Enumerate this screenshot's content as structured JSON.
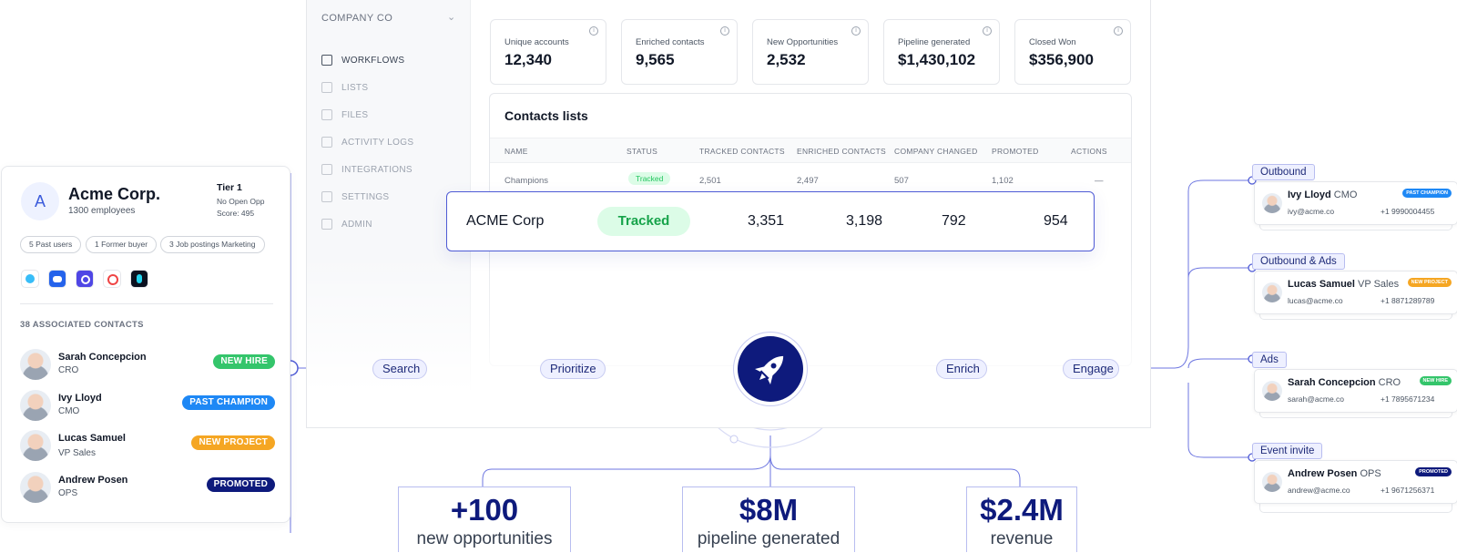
{
  "dashboard": {
    "company": "COMPANY CO",
    "nav": [
      {
        "label": "WORKFLOWS",
        "icon": "contacts-book-icon",
        "active": true
      },
      {
        "label": "LISTS",
        "icon": "list-icon",
        "active": false
      },
      {
        "label": "FILES",
        "icon": "file-icon",
        "active": false
      },
      {
        "label": "ACTIVITY LOGS",
        "icon": "book-icon",
        "active": false
      },
      {
        "label": "INTEGRATIONS",
        "icon": "integrations-icon",
        "active": false
      },
      {
        "label": "SETTINGS",
        "icon": "gear-icon",
        "active": false
      },
      {
        "label": "ADMIN",
        "icon": "building-icon",
        "active": false
      }
    ],
    "stats": [
      {
        "label": "Unique accounts",
        "value": "12,340"
      },
      {
        "label": "Enriched contacts",
        "value": "9,565"
      },
      {
        "label": "New Opportunities",
        "value": "2,532"
      },
      {
        "label": "Pipeline generated",
        "value": "$1,430,102"
      },
      {
        "label": "Closed Won",
        "value": "$356,900"
      }
    ],
    "contacts_list": {
      "title": "Contacts lists",
      "columns": [
        "NAME",
        "STATUS",
        "TRACKED CONTACTS",
        "ENRICHED CONTACTS",
        "COMPANY CHANGED",
        "PROMOTED",
        "ACTIONS"
      ],
      "row": {
        "name": "Champions",
        "status": "Tracked",
        "tracked": "2,501",
        "enriched": "2,497",
        "changed": "507",
        "promoted": "1,102",
        "actions": "—"
      }
    }
  },
  "highlight_row": {
    "name": "ACME Corp",
    "status": "Tracked",
    "tracked": "3,351",
    "enriched": "3,198",
    "changed": "792",
    "promoted": "954"
  },
  "account": {
    "initial": "A",
    "name": "Acme Corp.",
    "employees": "1300 employees",
    "tier": "Tier 1",
    "opp": "No Open Opp",
    "score": "Score: 495",
    "chips": [
      "5 Past users",
      "1 Former buyer",
      "3 Job postings Marketing"
    ],
    "apps": [
      "salesforce-icon",
      "zoom-icon",
      "pointer-icon",
      "twilio-icon",
      "dark-app-icon"
    ],
    "contacts_heading": "38 ASSOCIATED CONTACTS",
    "contacts": [
      {
        "name": "Sarah Concepcion",
        "role": "CRO",
        "badge": "NEW HIRE",
        "color": "#34c56b"
      },
      {
        "name": "Ivy Lloyd",
        "role": "CMO",
        "badge": "PAST CHAMPION",
        "color": "#1e88f5"
      },
      {
        "name": "Lucas Samuel",
        "role": "VP Sales",
        "badge": "NEW PROJECT",
        "color": "#f5a623"
      },
      {
        "name": "Andrew Posen",
        "role": "OPS",
        "badge": "PROMOTED",
        "color": "#0e1a7c"
      }
    ]
  },
  "steps": [
    "Search",
    "Prioritize",
    "Enrich",
    "Engage"
  ],
  "kpis": [
    {
      "value": "+100",
      "label": "new opportunities"
    },
    {
      "value": "$8M",
      "label": "pipeline generated"
    },
    {
      "value": "$2.4M",
      "label": "revenue"
    }
  ],
  "engage": [
    {
      "channel": "Outbound",
      "name": "Ivy Lloyd",
      "role": "CMO",
      "email": "ivy@acme.co",
      "phone": "+1 9990004455",
      "badge": "PAST CHAMPION",
      "color": "#1e88f5"
    },
    {
      "channel": "Outbound & Ads",
      "name": "Lucas Samuel",
      "role": "VP Sales",
      "email": "lucas@acme.co",
      "phone": "+1 8871289789",
      "badge": "NEW PROJECT",
      "color": "#f5a623"
    },
    {
      "channel": "Ads",
      "name": "Sarah Concepcion",
      "role": "CRO",
      "email": "sarah@acme.co",
      "phone": "+1 7895671234",
      "badge": "NEW HIRE",
      "color": "#34c56b"
    },
    {
      "channel": "Event invite",
      "name": "Andrew Posen",
      "role": "OPS",
      "email": "andrew@acme.co",
      "phone": "+1 9671256371",
      "badge": "PROMOTED",
      "color": "#0e1a7c"
    }
  ],
  "colors": {
    "accent": "#0e1a7c",
    "wire": "#4f5bd5",
    "pill_bg": "#eef0ff"
  }
}
